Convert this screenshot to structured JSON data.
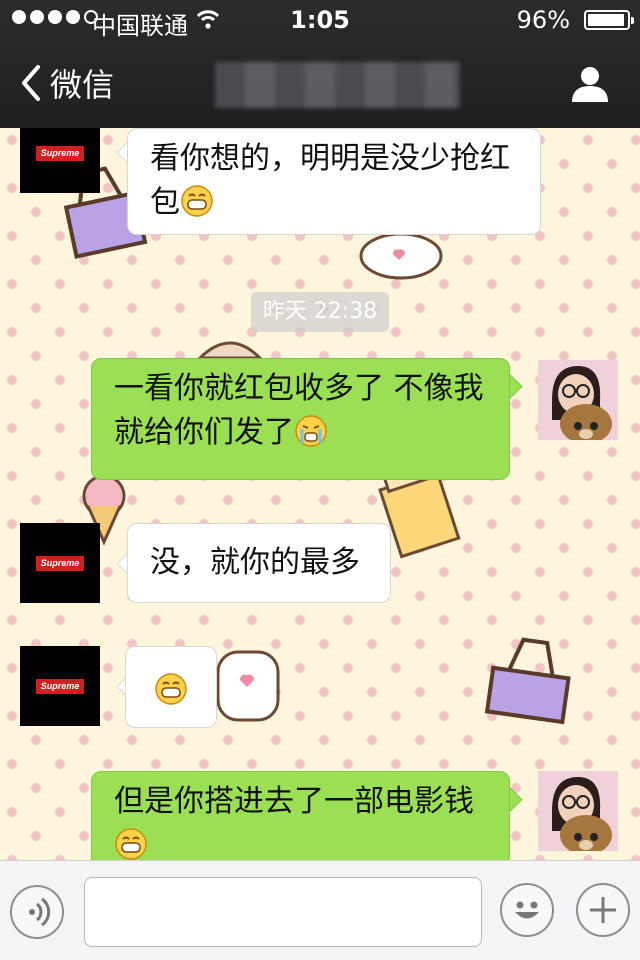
{
  "status_bar": {
    "carrier": "中国联通",
    "time": "1:05",
    "battery_percent_text": "96%",
    "battery_level": 0.96
  },
  "nav": {
    "back_label": "微信"
  },
  "chat": {
    "timestamp": "昨天 22:38",
    "messages": [
      {
        "side": "left",
        "text": "看你想的，明明是没少抢红包",
        "emoji": "grinning-face"
      },
      {
        "side": "right",
        "text": "一看你就红包收多了 不像我 就给你们发了",
        "emoji": "crying-face"
      },
      {
        "side": "left",
        "text": "没，就你的最多"
      },
      {
        "side": "left",
        "text": "",
        "emoji": "grinning-face"
      },
      {
        "side": "right",
        "text": "但是你搭进去了一部电影钱",
        "emoji": "grinning-face"
      }
    ]
  },
  "avatars": {
    "left_logo_text": "Supreme"
  },
  "icons": {
    "voice": "voice-icon",
    "emoji_button": "smiley-icon",
    "more": "plus-icon",
    "profile": "person-icon",
    "back": "chevron-left-icon"
  },
  "colors": {
    "topbar": "#262629",
    "green_bubble": "#9be054",
    "wallpaper": "#fdf6dc",
    "supreme_red": "#d21f1f"
  }
}
